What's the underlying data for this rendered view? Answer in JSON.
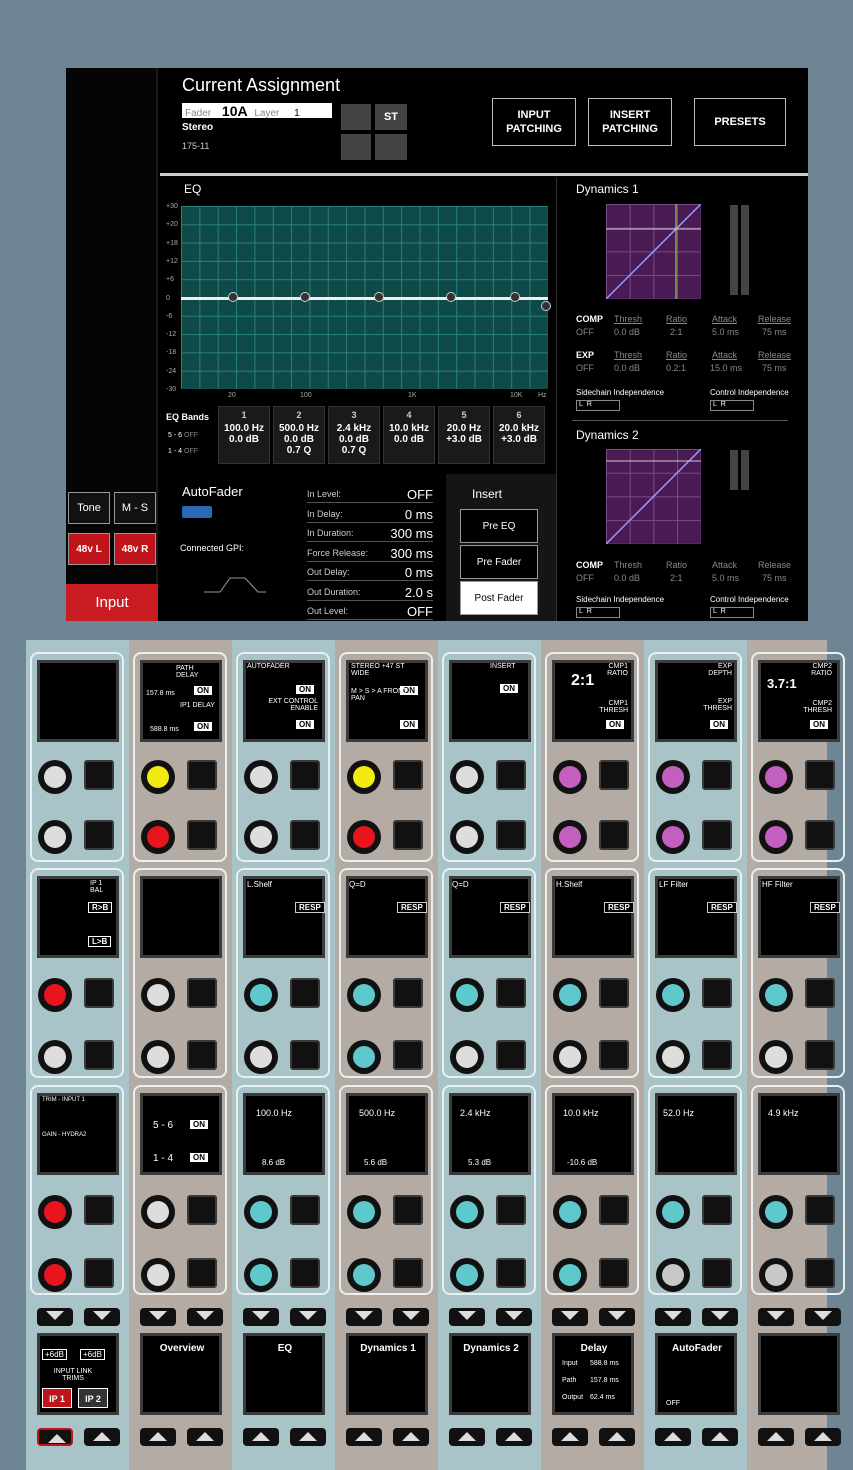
{
  "header": {
    "title": "Current Assignment",
    "fader_label": "Fader",
    "fader_value": "10A",
    "layer_label": "Layer",
    "layer_value": "1",
    "stereo": "Stereo",
    "id": "175-11",
    "st": "ST"
  },
  "buttons": {
    "input_patching": "INPUT PATCHING",
    "insert_patching": "INSERT PATCHING",
    "presets": "PRESETS"
  },
  "left": {
    "tone": "Tone",
    "ms": "M - S",
    "p48l": "48v L",
    "p48r": "48v R",
    "input": "Input"
  },
  "eq": {
    "title": "EQ",
    "y_labels": [
      "+30",
      "+20",
      "+18",
      "+12",
      "+6",
      "0",
      "-6",
      "-12",
      "-18",
      "-24",
      "-30"
    ],
    "x_labels": [
      "20",
      "100",
      "1K",
      "10K",
      "Hz"
    ],
    "bands_title": "EQ Bands",
    "b56": "5 - 6",
    "b14": "1 - 4",
    "off": "OFF",
    "bands": [
      {
        "n": "1",
        "f": "100.0 Hz",
        "g": "0.0 dB",
        "q": ""
      },
      {
        "n": "2",
        "f": "500.0 Hz",
        "g": "0.0 dB",
        "q": "0.7 Q"
      },
      {
        "n": "3",
        "f": "2.4 kHz",
        "g": "0.0 dB",
        "q": "0.7 Q"
      },
      {
        "n": "4",
        "f": "10.0 kHz",
        "g": "0.0 dB",
        "q": ""
      },
      {
        "n": "5",
        "f": "20.0 Hz",
        "g": "+3.0 dB",
        "q": ""
      },
      {
        "n": "6",
        "f": "20.0 kHz",
        "g": "+3.0 dB",
        "q": ""
      }
    ]
  },
  "dyn1": {
    "title": "Dynamics 1",
    "comp": "COMP",
    "exp": "EXP",
    "off": "OFF",
    "thresh": "Thresh",
    "ratio": "Ratio",
    "attack": "Attack",
    "release": "Release",
    "comp_vals": [
      "0.0 dB",
      "2:1",
      "5.0 ms",
      "75 ms"
    ],
    "exp_vals": [
      "0.0 dB",
      "0.2:1",
      "15.0 ms",
      "75 ms"
    ],
    "sidechain": "Sidechain Independence",
    "control": "Control Independence"
  },
  "dyn2": {
    "title": "Dynamics 2",
    "comp": "COMP",
    "off": "OFF",
    "thresh": "Thresh",
    "ratio": "Ratio",
    "attack": "Attack",
    "release": "Release",
    "comp_vals": [
      "0.0 dB",
      "2:1",
      "5.0 ms",
      "75 ms"
    ],
    "sidechain": "Sidechain Independence",
    "control": "Control Independence"
  },
  "autofader": {
    "title": "AutoFader",
    "gpi": "Connected GPI:",
    "rows": [
      {
        "k": "In Level:",
        "v": "OFF"
      },
      {
        "k": "In Delay:",
        "v": "0 ms"
      },
      {
        "k": "In Duration:",
        "v": "300 ms"
      },
      {
        "k": "Force Release:",
        "v": "300 ms"
      },
      {
        "k": "Out Delay:",
        "v": "0 ms"
      },
      {
        "k": "Out Duration:",
        "v": "2.0 s"
      },
      {
        "k": "Out Level:",
        "v": "OFF"
      }
    ]
  },
  "insert": {
    "title": "Insert",
    "pre_eq": "Pre EQ",
    "pre_fader": "Pre Fader",
    "post_fader": "Post Fader"
  },
  "screens": {
    "path_delay": "PATH DELAY",
    "delay1": "157.8 ms",
    "delay2": "588.8 ms",
    "ip1_delay": "IP1 DELAY",
    "on": "ON",
    "autofader": "AUTOFADER",
    "ext_ctrl": "EXT CONTROL ENABLE",
    "stereo_st": "STEREO +47 ST WIDE",
    "ms_front": "M > S > A FRONT PAN",
    "insert": "INSERT",
    "cmp1_ratio": "2:1",
    "cmp1_label": "CMP1 RATIO",
    "cmp1_thresh": "CMP1 THRESH",
    "exp_depth": "EXP DEPTH",
    "exp_thresh": "EXP THRESH",
    "cmp2_ratio": "3.7:1",
    "cmp2_label": "CMP2 RATIO",
    "cmp2_thresh": "CMP2 THRESH",
    "ip1_bal": "IP 1 BAL",
    "rb": "R>B",
    "lb": "L>B",
    "lshelf": "L.Shelf",
    "qd": "Q=D",
    "hshelf": "H.Shelf",
    "lff": "LF Filter",
    "hff": "HF Filter",
    "resp": "RESP",
    "trim": "TRIM - INPUT 1",
    "gain": "GAIN - HYDRA2",
    "b56": "5 - 6",
    "b14": "1 - 4",
    "freqs": [
      "100.0 Hz",
      "500.0 Hz",
      "2.4 kHz",
      "10.0 kHz",
      "52.0 Hz",
      "4.9 kHz"
    ],
    "gains": [
      "8.6 dB",
      "5.6 dB",
      "5.3 dB",
      "-10.6 dB"
    ]
  },
  "bottom": {
    "trim_a": "+6dB",
    "trim_b": "+6dB",
    "link": "INPUT LINK TRIMS",
    "ip1": "IP 1",
    "ip2": "IP 2",
    "overview": "Overview",
    "eq": "EQ",
    "dyn1": "Dynamics 1",
    "dyn2": "Dynamics 2",
    "delay": "Delay",
    "delay_input": "Input",
    "delay_input_v": "588.8 ms",
    "delay_path": "Path",
    "delay_path_v": "157.8 ms",
    "delay_output": "Output",
    "delay_output_v": "62.4 ms",
    "autofader": "AutoFader",
    "off": "OFF"
  }
}
